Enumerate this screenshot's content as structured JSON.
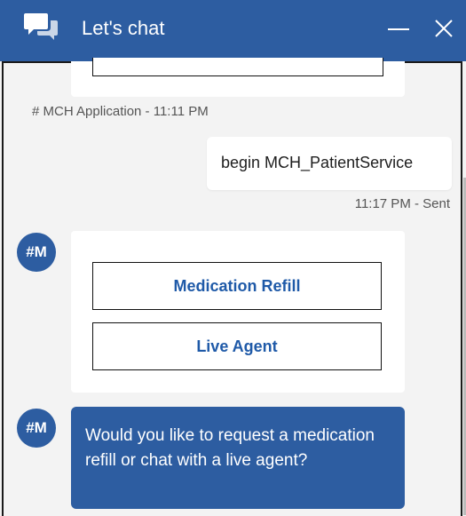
{
  "window": {
    "title": "Let's chat",
    "accent_color": "#2d5da1",
    "icons": {
      "chat": "chat-bubbles-icon",
      "minimize": "minimize-icon",
      "close": "close-icon"
    }
  },
  "messages": {
    "prev_meta": "# MCH Application - 11:11 PM",
    "user_message": "begin MCH_PatientService",
    "user_meta": "11:17 PM - Sent",
    "avatar_label": "#M",
    "card_buttons": [
      "Medication Refill",
      "Live Agent"
    ],
    "bot_message": "Would you like to request a medication refill or chat with a live agent?"
  }
}
